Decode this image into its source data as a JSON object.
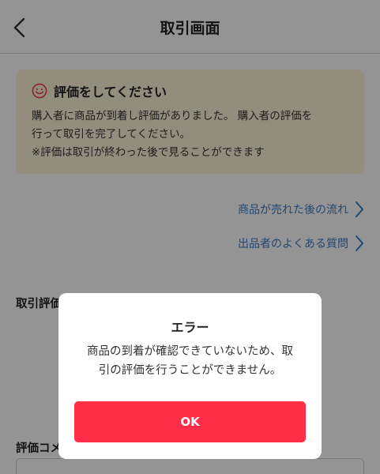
{
  "header": {
    "title": "取引画面",
    "back_icon": "chevron-left-icon"
  },
  "notice": {
    "icon": "smiley-face-icon",
    "title": "評価をしてください",
    "lines": [
      "購入者に商品が到着し評価がありました。 購入者の評価を",
      "行って取引を完了してください。",
      "※評価は取引が終わった後で見ることができます"
    ]
  },
  "links": [
    {
      "label": "商品が売れた後の流れ",
      "icon": "chevron-right-icon"
    },
    {
      "label": "出品者のよくある質問",
      "icon": "chevron-right-icon"
    }
  ],
  "sections": {
    "evaluation_label": "取引評価",
    "comment_label": "評価コメ"
  },
  "dialog": {
    "title": "エラー",
    "message_lines": [
      "商品の到着が確認できていないため、取",
      "引の評価を行うことができません。"
    ],
    "ok_label": "OK"
  },
  "colors": {
    "accent_red": "#ff2e48",
    "link_blue": "#3a7bc8",
    "notice_bg": "#fbf3d6"
  }
}
